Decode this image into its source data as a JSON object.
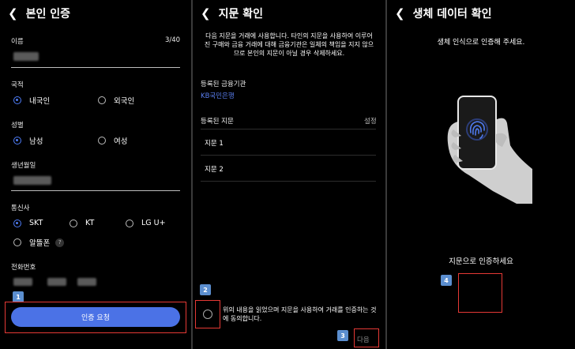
{
  "screen1": {
    "title": "본인 인증",
    "name_label": "이름",
    "name_counter": "3/40",
    "nationality_label": "국적",
    "nationality_options": [
      "내국인",
      "외국인"
    ],
    "gender_label": "성별",
    "gender_options": [
      "남성",
      "여성"
    ],
    "birth_label": "생년월일",
    "carrier_label": "통신사",
    "carrier_options": [
      "SKT",
      "KT",
      "LG U+",
      "알뜰폰"
    ],
    "help_mark": "?",
    "phone_label": "전화번호",
    "request_button": "인증 요청",
    "badge": "1"
  },
  "screen2": {
    "title": "지문 확인",
    "notice": "다음 지문을 거래에 사용합니다. 타인의 지문을 사용하여 이루어진 구매와 금융 거래에 대해 금융기관은 일체의 책임을 지지 않으므로 본인의 지문이 아닐 경우 삭제하세요.",
    "institution_label": "등록된 금융기관",
    "institution_name": "KB국민은행",
    "fingerprint_label": "등록된 지문",
    "settings_link": "설정",
    "fingerprints": [
      "지문 1",
      "지문 2"
    ],
    "agree_text": "위의 내용을 읽었으며 지문을 사용하여 거래를 인증하는 것에 동의합니다.",
    "next_button": "다음",
    "badge_checkbox": "2",
    "badge_next": "3"
  },
  "screen3": {
    "title": "생체 데이터 확인",
    "subtitle": "생체 인식으로 인증해 주세요.",
    "prompt": "지문으로 인증하세요",
    "badge": "4"
  },
  "colors": {
    "accent": "#4b72e6",
    "link": "#5a7ff0",
    "highlight_box": "#e53935",
    "badge": "#5b8ecf"
  },
  "icons": [
    "back-arrow-icon",
    "fingerprint-icon",
    "hand-holding-phone-icon"
  ]
}
